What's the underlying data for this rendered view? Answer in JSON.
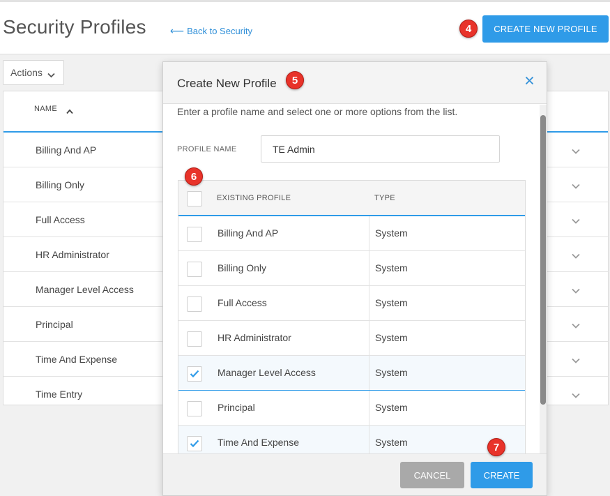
{
  "header": {
    "title": "Security Profiles",
    "back_link": "Back to Security",
    "create_button": "CREATE NEW PROFILE"
  },
  "actions": {
    "label": "Actions"
  },
  "list": {
    "column_name": "NAME",
    "rows": [
      {
        "name": "Billing And AP"
      },
      {
        "name": "Billing Only"
      },
      {
        "name": "Full Access"
      },
      {
        "name": "HR Administrator"
      },
      {
        "name": "Manager Level Access"
      },
      {
        "name": "Principal"
      },
      {
        "name": "Time And Expense"
      },
      {
        "name": "Time Entry"
      }
    ]
  },
  "modal": {
    "title": "Create New Profile",
    "instructions": "Enter a profile name and select one or more options from the list.",
    "profile_name_label": "PROFILE NAME",
    "profile_name_value": "TE Admin",
    "table": {
      "col_existing": "EXISTING PROFILE",
      "col_type": "TYPE",
      "rows": [
        {
          "name": "Billing And AP",
          "type": "System",
          "checked": false
        },
        {
          "name": "Billing Only",
          "type": "System",
          "checked": false
        },
        {
          "name": "Full Access",
          "type": "System",
          "checked": false
        },
        {
          "name": "HR Administrator",
          "type": "System",
          "checked": false
        },
        {
          "name": "Manager Level Access",
          "type": "System",
          "checked": true
        },
        {
          "name": "Principal",
          "type": "System",
          "checked": false
        },
        {
          "name": "Time And Expense",
          "type": "System",
          "checked": true
        }
      ]
    },
    "cancel_button": "CANCEL",
    "create_button": "CREATE"
  },
  "markers": [
    "4",
    "5",
    "6",
    "7"
  ],
  "colors": {
    "accent": "#2f9be8",
    "marker": "#e8332a",
    "cancel": "#a9a9a9"
  }
}
